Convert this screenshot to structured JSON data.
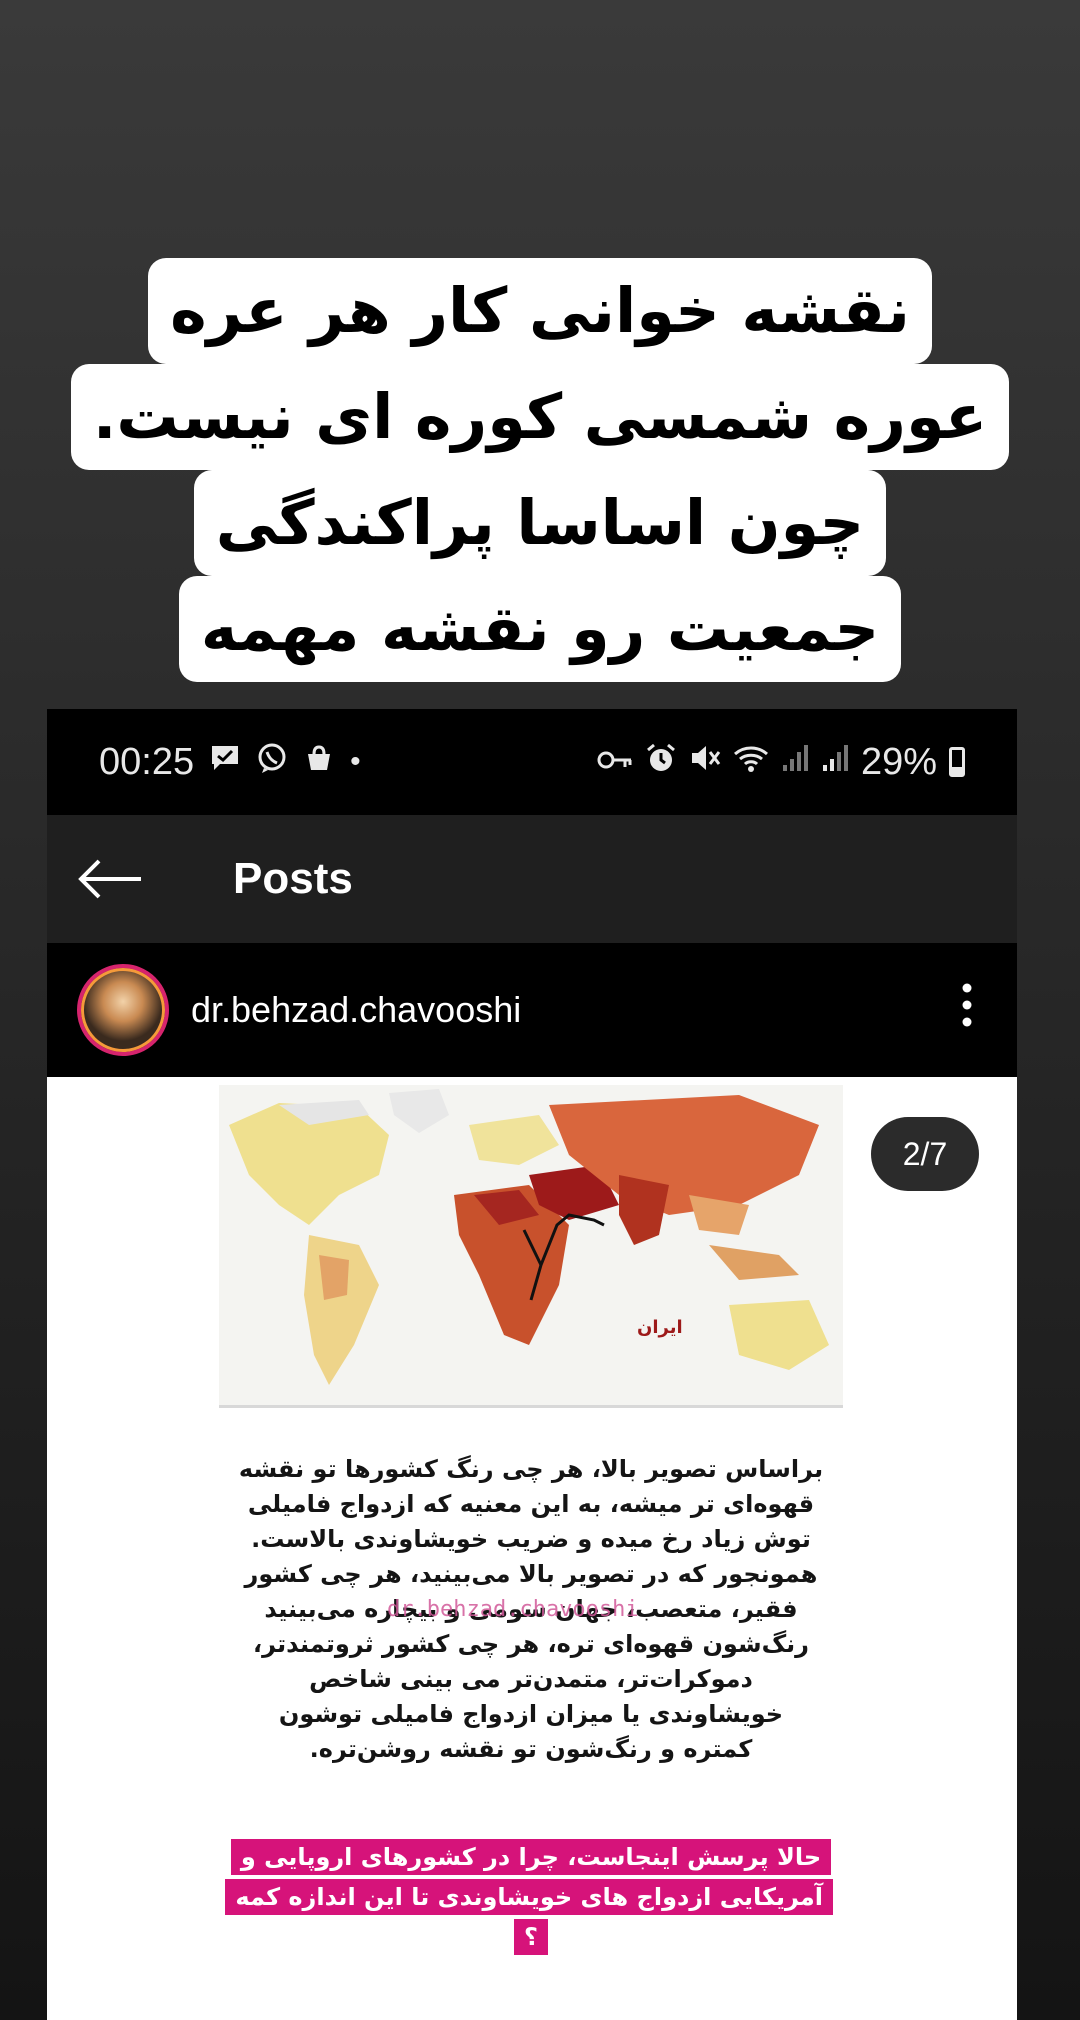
{
  "caption": {
    "lines": [
      "نقشه خوانی کار هر عره",
      "عوره شمسی کوره ای نیست.",
      "چون اساسا پراکندگی",
      "جمعیت رو نقشه مهمه"
    ]
  },
  "status_bar": {
    "time": "00:25",
    "battery": "29%",
    "battery_level": 0.29,
    "icons_left": [
      "chat-icon",
      "viber-icon",
      "shop-bag-icon",
      "dot-icon"
    ],
    "icons_right": [
      "key-icon",
      "alarm-icon",
      "mute-icon",
      "wifi-icon",
      "signal-icon",
      "signal-icon"
    ]
  },
  "app_bar": {
    "title": "Posts",
    "back_icon": "arrow-left-icon"
  },
  "post": {
    "username": "dr.behzad.chavooshi",
    "counter": "2/7",
    "map_label": "ایران",
    "watermark": "dr.behzad.chavooshi",
    "body_lines": [
      "براساس تصویر بالا، هر چی رنگ کشورها تو نقشه",
      "قهوه‌ای تر میشه، به این معنیه که ازدواج فامیلی",
      "توش زیاد رخ میده و ضریب خویشاوندی بالاست.",
      "همونجور که در تصویر بالا می‌بینید، هر چی کشور",
      "فقیر، متعصب، جهان سومی و بیچاره می‌بینید",
      "رنگ‌شون قهوه‌ای تره، هر چی کشور ثروتمندتر،",
      "دموکرات‌تر، متمدن‌تر می بینی شاخص",
      "خویشاوندی یا میزان ازدواج فامیلی توشون",
      "کمتره و رنگ‌شون تو نقشه روشن‌تره."
    ],
    "highlight": "حالا پرسش اینجاست، چرا در کشورهای اروپایی و آمریکایی ازدواج های خویشاوندی تا این اندازه کمه ؟"
  },
  "colors": {
    "highlight": "#d6137a",
    "map_dark": "#9d1a1a",
    "map_mid": "#d9663d",
    "map_light": "#f0d98c"
  }
}
